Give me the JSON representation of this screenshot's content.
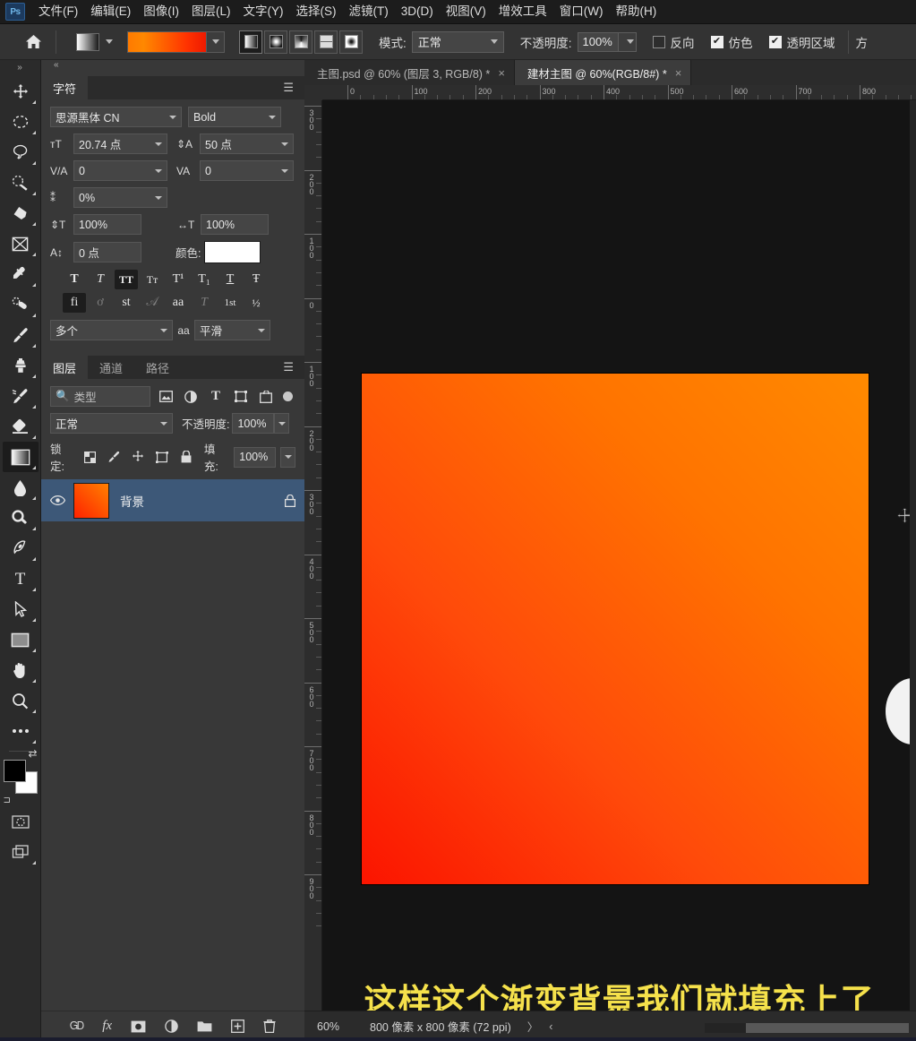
{
  "app": {
    "logo": "Ps"
  },
  "menubar": {
    "items": [
      {
        "label": "文件(F)",
        "name": "menu-file"
      },
      {
        "label": "编辑(E)",
        "name": "menu-edit"
      },
      {
        "label": "图像(I)",
        "name": "menu-image"
      },
      {
        "label": "图层(L)",
        "name": "menu-layer"
      },
      {
        "label": "文字(Y)",
        "name": "menu-type"
      },
      {
        "label": "选择(S)",
        "name": "menu-select"
      },
      {
        "label": "滤镜(T)",
        "name": "menu-filter"
      },
      {
        "label": "3D(D)",
        "name": "menu-3d"
      },
      {
        "label": "视图(V)",
        "name": "menu-view"
      },
      {
        "label": "增效工具",
        "name": "menu-plugins"
      },
      {
        "label": "窗口(W)",
        "name": "menu-window"
      },
      {
        "label": "帮助(H)",
        "name": "menu-help"
      }
    ]
  },
  "options": {
    "home_icon": "home-icon",
    "gradient_preset_icon": "gradient-preset-swatch",
    "gradient_bar_icon": "gradient-editor-bar",
    "gradient_types": [
      {
        "name": "gradient-type-linear",
        "label": "线性渐变",
        "active": true
      },
      {
        "name": "gradient-type-radial",
        "label": "径向渐变",
        "active": false
      },
      {
        "name": "gradient-type-angle",
        "label": "角度渐变",
        "active": false
      },
      {
        "name": "gradient-type-reflected",
        "label": "对称渐变",
        "active": false
      },
      {
        "name": "gradient-type-diamond",
        "label": "菱形渐变",
        "active": false
      }
    ],
    "mode_label": "模式:",
    "mode_value": "正常",
    "opacity_label": "不透明度:",
    "opacity_value": "100%",
    "reverse_label": "反向",
    "reverse_checked": false,
    "dither_label": "仿色",
    "dither_checked": true,
    "transparency_label": "透明区域",
    "transparency_checked": true,
    "extra_label": "方"
  },
  "toolbar": {
    "expand_icon": "chevron-double-right-icon",
    "tools": [
      {
        "name": "tool-move",
        "label": "移动工具"
      },
      {
        "name": "tool-marquee",
        "label": "选框工具"
      },
      {
        "name": "tool-lasso",
        "label": "套索工具"
      },
      {
        "name": "tool-quick-selection",
        "label": "快速选择工具"
      },
      {
        "name": "tool-crop",
        "label": "裁剪工具"
      },
      {
        "name": "tool-frame",
        "label": "画框工具"
      },
      {
        "name": "tool-eyedropper",
        "label": "吸管工具"
      },
      {
        "name": "tool-healing-brush",
        "label": "修复画笔工具"
      },
      {
        "name": "tool-brush",
        "label": "画笔工具"
      },
      {
        "name": "tool-clone-stamp",
        "label": "仿制图章工具"
      },
      {
        "name": "tool-history-brush",
        "label": "历史记录画笔工具"
      },
      {
        "name": "tool-eraser",
        "label": "橡皮擦工具"
      },
      {
        "name": "tool-gradient",
        "label": "渐变工具",
        "active": true
      },
      {
        "name": "tool-blur",
        "label": "模糊工具"
      },
      {
        "name": "tool-dodge",
        "label": "减淡工具"
      },
      {
        "name": "tool-pen",
        "label": "钢笔工具"
      },
      {
        "name": "tool-type",
        "label": "文字工具"
      },
      {
        "name": "tool-path-selection",
        "label": "路径选择工具"
      },
      {
        "name": "tool-rectangle",
        "label": "矩形工具"
      },
      {
        "name": "tool-hand",
        "label": "抓手工具"
      },
      {
        "name": "tool-zoom",
        "label": "缩放工具"
      },
      {
        "name": "tool-more",
        "label": "编辑工具栏"
      }
    ],
    "swap_icon": "swap-colors-icon",
    "default_icon": "default-colors-icon",
    "quickmask_icon": "quick-mask-icon",
    "screenmode_icon": "screen-mode-icon"
  },
  "character_panel": {
    "collapse_icon": "chevron-double-left-icon",
    "tabs": [
      {
        "label": "字符",
        "active": true
      }
    ],
    "menu_icon": "panel-menu-icon",
    "font_family": "思源黑体 CN",
    "font_style": "Bold",
    "font_size_icon": "font-size-icon",
    "font_size": "20.74 点",
    "leading_icon": "leading-icon",
    "leading": "50 点",
    "kerning_icon": "kerning-icon",
    "kerning": "0",
    "tracking_icon": "tracking-icon",
    "tracking": "0",
    "vscale_label_icon": "vertical-scale-icon",
    "hscale_label_icon": "horizontal-scale-icon",
    "text_scale_pct": "0%",
    "vertical_scale": "100%",
    "horizontal_scale": "100%",
    "baseline_icon": "baseline-shift-icon",
    "baseline_shift": "0 点",
    "color_label": "颜色:",
    "color_value": "#FFFFFF",
    "style_buttons_row1": [
      {
        "name": "faux-bold-button",
        "glyph": "T",
        "on": false
      },
      {
        "name": "faux-italic-button",
        "glyph": "T",
        "on": false
      },
      {
        "name": "all-caps-button",
        "glyph": "TT",
        "on": true
      },
      {
        "name": "small-caps-button",
        "glyph": "Tт",
        "on": false
      },
      {
        "name": "superscript-button",
        "glyph": "T¹",
        "on": false
      },
      {
        "name": "subscript-button",
        "glyph": "T₁",
        "on": false
      },
      {
        "name": "underline-button",
        "glyph": "T",
        "on": false
      },
      {
        "name": "strikethrough-button",
        "glyph": "Ŧ",
        "on": false
      }
    ],
    "style_buttons_row2": [
      {
        "name": "standard-ligatures-button",
        "glyph": "fi",
        "on": true
      },
      {
        "name": "contextual-alternates-button",
        "glyph": "ơ",
        "on": false
      },
      {
        "name": "discretionary-ligatures-button",
        "glyph": "st",
        "on": false
      },
      {
        "name": "swash-button",
        "glyph": "𝒜",
        "on": false
      },
      {
        "name": "stylistic-alternates-button",
        "glyph": "aa",
        "on": false
      },
      {
        "name": "titling-alternates-button",
        "glyph": "T",
        "on": false
      },
      {
        "name": "ordinals-button",
        "glyph": "1st",
        "on": false
      },
      {
        "name": "fractions-button",
        "glyph": "½",
        "on": false
      }
    ],
    "language": "多个",
    "aa_icon": "anti-alias-icon",
    "anti_alias": "平滑"
  },
  "layers_panel": {
    "tabs": [
      {
        "label": "图层",
        "active": true,
        "name": "tab-layers"
      },
      {
        "label": "通道",
        "active": false,
        "name": "tab-channels"
      },
      {
        "label": "路径",
        "active": false,
        "name": "tab-paths"
      }
    ],
    "menu_icon": "panel-menu-icon",
    "filter_placeholder": "类型",
    "filter_icons": [
      {
        "name": "filter-pixel-icon"
      },
      {
        "name": "filter-adjustment-icon"
      },
      {
        "name": "filter-type-icon"
      },
      {
        "name": "filter-shape-icon"
      },
      {
        "name": "filter-smart-object-icon"
      }
    ],
    "filter_toggle_icon": "filter-toggle-switch",
    "blend_mode": "正常",
    "opacity_label": "不透明度:",
    "opacity_value": "100%",
    "lock_label": "锁定:",
    "lock_icons": [
      {
        "name": "lock-transparent-pixels-icon"
      },
      {
        "name": "lock-image-pixels-icon"
      },
      {
        "name": "lock-position-icon"
      },
      {
        "name": "lock-artboard-nesting-icon"
      },
      {
        "name": "lock-all-icon"
      }
    ],
    "fill_label": "填充:",
    "fill_value": "100%",
    "layers": [
      {
        "name": "背景",
        "visible": true,
        "locked": true,
        "selected": true,
        "thumb": "orange-red-gradient"
      }
    ],
    "footer_buttons": [
      {
        "name": "link-layers-button",
        "glyph": "GÐ"
      },
      {
        "name": "layer-style-button",
        "glyph": "fx"
      },
      {
        "name": "layer-mask-button",
        "glyph": "mask"
      },
      {
        "name": "adjustment-layer-button",
        "glyph": "half-circle"
      },
      {
        "name": "new-group-button",
        "glyph": "folder"
      },
      {
        "name": "new-layer-button",
        "glyph": "plus-square"
      },
      {
        "name": "delete-layer-button",
        "glyph": "trash"
      }
    ]
  },
  "document": {
    "tabs": [
      {
        "label": "主图.psd @ 60% (图层 3, RGB/8) *",
        "active": false,
        "name": "doc-tab-zhutu"
      },
      {
        "label": "建材主图 @ 60%(RGB/8#) *",
        "active": true,
        "name": "doc-tab-jiancai"
      }
    ],
    "close_icon": "close-icon",
    "ruler_h_ticks": [
      "0",
      "100",
      "200",
      "300",
      "400",
      "500",
      "600",
      "700",
      "800"
    ],
    "ruler_v_ticks": [
      "300",
      "200",
      "100",
      "0",
      "100",
      "200",
      "300",
      "400",
      "500",
      "600",
      "700",
      "800",
      "900"
    ],
    "canvas_gradient_from": "#FF8A00",
    "canvas_gradient_to": "#FB1400",
    "cursor_icon": "move-cursor-icon"
  },
  "subtitle": {
    "text": "这样这个渐变背景我们就填充上了",
    "color": "#F5E14B"
  },
  "statusbar": {
    "zoom": "60%",
    "dimensions": "800 像素 x 800 像素 (72 ppi)",
    "next_icon": "chevron-right-icon",
    "prev_icon": "chevron-left-icon"
  }
}
